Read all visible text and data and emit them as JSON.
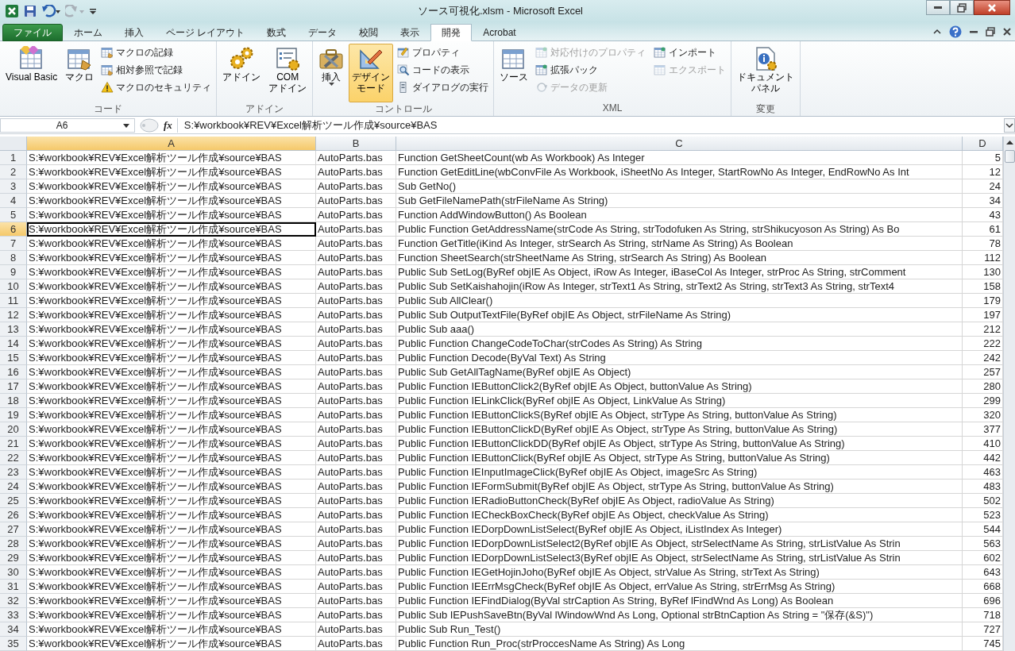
{
  "window": {
    "title": "ソース可視化.xlsm - Microsoft Excel"
  },
  "tabs": [
    {
      "label": "ファイル",
      "kind": "file",
      "selected": false
    },
    {
      "label": "ホーム",
      "kind": "tab",
      "selected": false
    },
    {
      "label": "挿入",
      "kind": "tab",
      "selected": false
    },
    {
      "label": "ページ レイアウト",
      "kind": "tab",
      "selected": false
    },
    {
      "label": "数式",
      "kind": "tab",
      "selected": false
    },
    {
      "label": "データ",
      "kind": "tab",
      "selected": false
    },
    {
      "label": "校閲",
      "kind": "tab",
      "selected": false
    },
    {
      "label": "表示",
      "kind": "tab",
      "selected": false
    },
    {
      "label": "開発",
      "kind": "tab",
      "selected": true
    },
    {
      "label": "Acrobat",
      "kind": "tab",
      "selected": false
    }
  ],
  "ribbon": {
    "groups": [
      {
        "label": "コード",
        "items": [
          {
            "kind": "large",
            "lines": [
              "Visual Basic"
            ],
            "on": false,
            "dropdown": false
          },
          {
            "kind": "large",
            "lines": [
              "マクロ"
            ],
            "on": false,
            "dropdown": false
          },
          {
            "kind": "small",
            "label": "マクロの記録",
            "disabled": false
          },
          {
            "kind": "small",
            "label": "相対参照で記録",
            "disabled": false
          },
          {
            "kind": "small",
            "label": "マクロのセキュリティ",
            "disabled": false
          }
        ]
      },
      {
        "label": "アドイン",
        "items": [
          {
            "kind": "large",
            "lines": [
              "アドイン"
            ],
            "on": false,
            "dropdown": false
          },
          {
            "kind": "large",
            "lines": [
              "COM",
              "アドイン"
            ],
            "on": false,
            "dropdown": false
          }
        ]
      },
      {
        "label": "コントロール",
        "items": [
          {
            "kind": "large",
            "lines": [
              "挿入"
            ],
            "on": false,
            "dropdown": true
          },
          {
            "kind": "large",
            "lines": [
              "デザイン",
              "モード"
            ],
            "on": true,
            "dropdown": false
          },
          {
            "kind": "small",
            "label": "プロパティ",
            "disabled": false
          },
          {
            "kind": "small",
            "label": "コードの表示",
            "disabled": false
          },
          {
            "kind": "small",
            "label": "ダイアログの実行",
            "disabled": false
          }
        ]
      },
      {
        "label": "XML",
        "items": [
          {
            "kind": "large",
            "lines": [
              "ソース"
            ],
            "on": false,
            "dropdown": false
          },
          {
            "kind": "small",
            "label": "対応付けのプロパティ",
            "disabled": true
          },
          {
            "kind": "small",
            "label": "拡張パック",
            "disabled": false
          },
          {
            "kind": "small",
            "label": "データの更新",
            "disabled": true
          },
          {
            "kind": "small",
            "label": "インポート",
            "disabled": false
          },
          {
            "kind": "small",
            "label": "エクスポート",
            "disabled": true
          }
        ]
      },
      {
        "label": "変更",
        "items": [
          {
            "kind": "large",
            "lines": [
              "ドキュメント",
              "パネル"
            ],
            "on": false,
            "dropdown": false
          }
        ]
      }
    ]
  },
  "formula_bar": {
    "name_box": "A6",
    "function_label": "fx",
    "formula": "S:¥workbook¥REV¥Excel解析ツール作成¥source¥BAS"
  },
  "sheet": {
    "columns": [
      {
        "label": "A",
        "selected": true
      },
      {
        "label": "B",
        "selected": false
      },
      {
        "label": "C",
        "selected": false
      },
      {
        "label": "D",
        "selected": false
      }
    ],
    "rows": [
      {
        "number": "1",
        "selected": false,
        "cells": [
          "S:¥workbook¥REV¥Excel解析ツール作成¥source¥BAS",
          "AutoParts.bas",
          "Function GetSheetCount(wb As Workbook) As Integer",
          "5"
        ]
      },
      {
        "number": "2",
        "selected": false,
        "cells": [
          "S:¥workbook¥REV¥Excel解析ツール作成¥source¥BAS",
          "AutoParts.bas",
          "Function GetEditLine(wbConvFile As Workbook, iSheetNo As Integer, StartRowNo As Integer, EndRowNo As Int",
          "12"
        ]
      },
      {
        "number": "3",
        "selected": false,
        "cells": [
          "S:¥workbook¥REV¥Excel解析ツール作成¥source¥BAS",
          "AutoParts.bas",
          "Sub GetNo()",
          "24"
        ]
      },
      {
        "number": "4",
        "selected": false,
        "cells": [
          "S:¥workbook¥REV¥Excel解析ツール作成¥source¥BAS",
          "AutoParts.bas",
          "Sub GetFileNamePath(strFileName As String)",
          "34"
        ]
      },
      {
        "number": "5",
        "selected": false,
        "cells": [
          "S:¥workbook¥REV¥Excel解析ツール作成¥source¥BAS",
          "AutoParts.bas",
          "Function AddWindowButton() As Boolean",
          "43"
        ]
      },
      {
        "number": "6",
        "selected": true,
        "cells": [
          "S:¥workbook¥REV¥Excel解析ツール作成¥source¥BAS",
          "AutoParts.bas",
          "Public Function GetAddressName(strCode As String, strTodofuken As String, strShikucyoson As String) As Bo",
          "61"
        ]
      },
      {
        "number": "7",
        "selected": false,
        "cells": [
          "S:¥workbook¥REV¥Excel解析ツール作成¥source¥BAS",
          "AutoParts.bas",
          "Function GetTitle(iKind As Integer, strSearch As String, strName As String) As Boolean",
          "78"
        ]
      },
      {
        "number": "8",
        "selected": false,
        "cells": [
          "S:¥workbook¥REV¥Excel解析ツール作成¥source¥BAS",
          "AutoParts.bas",
          "Function SheetSearch(strSheetName As String, strSearch As String) As Boolean",
          "112"
        ]
      },
      {
        "number": "9",
        "selected": false,
        "cells": [
          "S:¥workbook¥REV¥Excel解析ツール作成¥source¥BAS",
          "AutoParts.bas",
          "Public Sub SetLog(ByRef objIE As Object, iRow As Integer, iBaseCol As Integer, strProc As String, strComment",
          "130"
        ]
      },
      {
        "number": "10",
        "selected": false,
        "cells": [
          "S:¥workbook¥REV¥Excel解析ツール作成¥source¥BAS",
          "AutoParts.bas",
          "Public Sub SetKaishahojin(iRow As Integer, strText1 As String, strText2 As String, strText3 As String, strText4",
          "158"
        ]
      },
      {
        "number": "11",
        "selected": false,
        "cells": [
          "S:¥workbook¥REV¥Excel解析ツール作成¥source¥BAS",
          "AutoParts.bas",
          "Public Sub AllClear()",
          "179"
        ]
      },
      {
        "number": "12",
        "selected": false,
        "cells": [
          "S:¥workbook¥REV¥Excel解析ツール作成¥source¥BAS",
          "AutoParts.bas",
          "Public Sub OutputTextFile(ByRef objIE As Object, strFileName As String)",
          "197"
        ]
      },
      {
        "number": "13",
        "selected": false,
        "cells": [
          "S:¥workbook¥REV¥Excel解析ツール作成¥source¥BAS",
          "AutoParts.bas",
          "Public Sub aaa()",
          "212"
        ]
      },
      {
        "number": "14",
        "selected": false,
        "cells": [
          "S:¥workbook¥REV¥Excel解析ツール作成¥source¥BAS",
          "AutoParts.bas",
          "Public Function ChangeCodeToChar(strCodes As String) As String",
          "222"
        ]
      },
      {
        "number": "15",
        "selected": false,
        "cells": [
          "S:¥workbook¥REV¥Excel解析ツール作成¥source¥BAS",
          "AutoParts.bas",
          "Public Function Decode(ByVal Text) As String",
          "242"
        ]
      },
      {
        "number": "16",
        "selected": false,
        "cells": [
          "S:¥workbook¥REV¥Excel解析ツール作成¥source¥BAS",
          "AutoParts.bas",
          "Public Sub GetAllTagName(ByRef objIE As Object)",
          "257"
        ]
      },
      {
        "number": "17",
        "selected": false,
        "cells": [
          "S:¥workbook¥REV¥Excel解析ツール作成¥source¥BAS",
          "AutoParts.bas",
          "Public Function IEButtonClick2(ByRef objIE As Object, buttonValue As String)",
          "280"
        ]
      },
      {
        "number": "18",
        "selected": false,
        "cells": [
          "S:¥workbook¥REV¥Excel解析ツール作成¥source¥BAS",
          "AutoParts.bas",
          "Public Function IELinkClick(ByRef objIE As Object, LinkValue As String)",
          "299"
        ]
      },
      {
        "number": "19",
        "selected": false,
        "cells": [
          "S:¥workbook¥REV¥Excel解析ツール作成¥source¥BAS",
          "AutoParts.bas",
          "Public Function IEButtonClickS(ByRef objIE As Object, strType As String, buttonValue As String)",
          "320"
        ]
      },
      {
        "number": "20",
        "selected": false,
        "cells": [
          "S:¥workbook¥REV¥Excel解析ツール作成¥source¥BAS",
          "AutoParts.bas",
          "Public Function IEButtonClickD(ByRef objIE As Object, strType As String, buttonValue As String)",
          "377"
        ]
      },
      {
        "number": "21",
        "selected": false,
        "cells": [
          "S:¥workbook¥REV¥Excel解析ツール作成¥source¥BAS",
          "AutoParts.bas",
          "Public Function IEButtonClickDD(ByRef objIE As Object, strType As String, buttonValue As String)",
          "410"
        ]
      },
      {
        "number": "22",
        "selected": false,
        "cells": [
          "S:¥workbook¥REV¥Excel解析ツール作成¥source¥BAS",
          "AutoParts.bas",
          "Public Function IEButtonClick(ByRef objIE As Object, strType As String, buttonValue As String)",
          "442"
        ]
      },
      {
        "number": "23",
        "selected": false,
        "cells": [
          "S:¥workbook¥REV¥Excel解析ツール作成¥source¥BAS",
          "AutoParts.bas",
          "Public Function IEInputImageClick(ByRef objIE As Object, imageSrc As String)",
          "463"
        ]
      },
      {
        "number": "24",
        "selected": false,
        "cells": [
          "S:¥workbook¥REV¥Excel解析ツール作成¥source¥BAS",
          "AutoParts.bas",
          "Public Function IEFormSubmit(ByRef objIE As Object, strType As String, buttonValue As String)",
          "483"
        ]
      },
      {
        "number": "25",
        "selected": false,
        "cells": [
          "S:¥workbook¥REV¥Excel解析ツール作成¥source¥BAS",
          "AutoParts.bas",
          "Public Function IERadioButtonCheck(ByRef objIE As Object, radioValue As String)",
          "502"
        ]
      },
      {
        "number": "26",
        "selected": false,
        "cells": [
          "S:¥workbook¥REV¥Excel解析ツール作成¥source¥BAS",
          "AutoParts.bas",
          "Public Function IECheckBoxCheck(ByRef objIE As Object, checkValue As String)",
          "523"
        ]
      },
      {
        "number": "27",
        "selected": false,
        "cells": [
          "S:¥workbook¥REV¥Excel解析ツール作成¥source¥BAS",
          "AutoParts.bas",
          "Public Function IEDorpDownListSelect(ByRef objIE As Object, iListIndex As Integer)",
          "544"
        ]
      },
      {
        "number": "28",
        "selected": false,
        "cells": [
          "S:¥workbook¥REV¥Excel解析ツール作成¥source¥BAS",
          "AutoParts.bas",
          "Public Function IEDorpDownListSelect2(ByRef objIE As Object, strSelectName As String, strListValue As Strin",
          "563"
        ]
      },
      {
        "number": "29",
        "selected": false,
        "cells": [
          "S:¥workbook¥REV¥Excel解析ツール作成¥source¥BAS",
          "AutoParts.bas",
          "Public Function IEDorpDownListSelect3(ByRef objIE As Object, strSelectName As String, strListValue As Strin",
          "602"
        ]
      },
      {
        "number": "30",
        "selected": false,
        "cells": [
          "S:¥workbook¥REV¥Excel解析ツール作成¥source¥BAS",
          "AutoParts.bas",
          "Public Function IEGetHojinJoho(ByRef objIE As Object, strValue As String, strText As String)",
          "643"
        ]
      },
      {
        "number": "31",
        "selected": false,
        "cells": [
          "S:¥workbook¥REV¥Excel解析ツール作成¥source¥BAS",
          "AutoParts.bas",
          "Public Function IEErrMsgCheck(ByRef objIE As Object, errValue As String, strErrMsg As String)",
          "668"
        ]
      },
      {
        "number": "32",
        "selected": false,
        "cells": [
          "S:¥workbook¥REV¥Excel解析ツール作成¥source¥BAS",
          "AutoParts.bas",
          "Public Function IEFindDialog(ByVal strCaption As String, ByRef lFindWnd As Long) As Boolean",
          "696"
        ]
      },
      {
        "number": "33",
        "selected": false,
        "cells": [
          "S:¥workbook¥REV¥Excel解析ツール作成¥source¥BAS",
          "AutoParts.bas",
          "Public Sub IEPushSaveBtn(ByVal lWindowWnd As Long, Optional strBtnCaption As String = \"保存(&S)\")",
          "718"
        ]
      },
      {
        "number": "34",
        "selected": false,
        "cells": [
          "S:¥workbook¥REV¥Excel解析ツール作成¥source¥BAS",
          "AutoParts.bas",
          "Public Sub Run_Test()",
          "727"
        ]
      },
      {
        "number": "35",
        "selected": false,
        "cells": [
          "S:¥workbook¥REV¥Excel解析ツール作成¥source¥BAS",
          "AutoParts.bas",
          "Public Function Run_Proc(strProccesName As String) As Long",
          "745"
        ]
      }
    ]
  }
}
